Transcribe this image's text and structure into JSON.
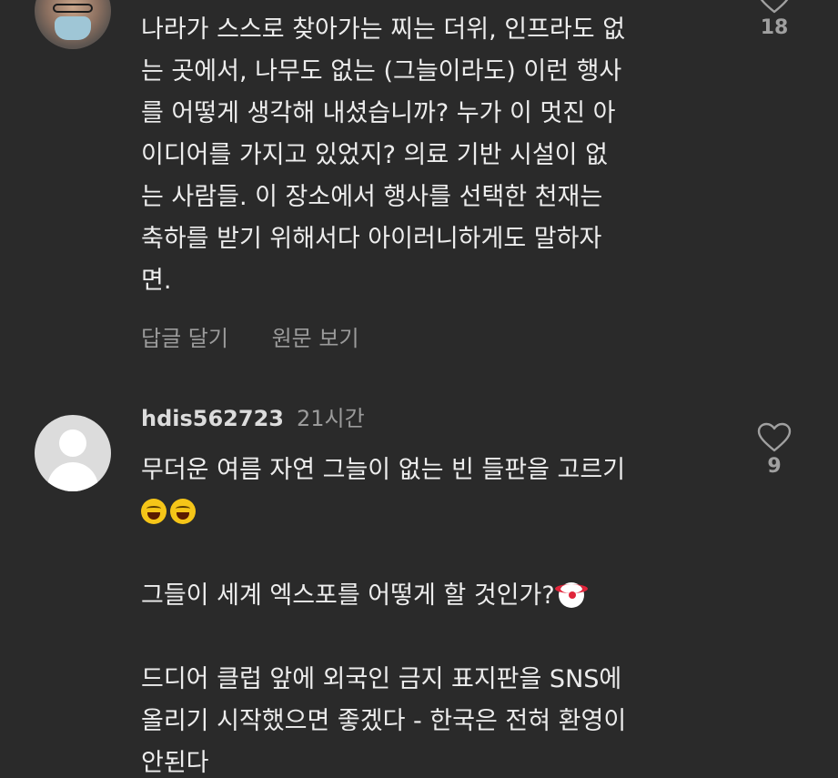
{
  "comments": [
    {
      "username": "",
      "time": "",
      "lines": [
        "나라가 스스로 찾아가는 찌는 더위, 인프라도 없",
        "는 곳에서, 나무도 없는 (그늘이라도) 이런 행사",
        "를 어떻게 생각해 내셨습니까? 누가 이 멋진 아",
        "이디어를 가지고 있었지? 의료 기반 시설이 없",
        "는 사람들. 이 장소에서 행사를 선택한 천재는",
        "축하를 받기 위해서다 아이러니하게도 말하자",
        "면."
      ],
      "likes": "18",
      "actions": {
        "reply": "답글 달기",
        "view_original": "원문 보기"
      }
    },
    {
      "username": "hdis562723",
      "time": "21시간",
      "lines": [
        "무더운 여름 자연 그늘이 없는 빈 들판을 고르기",
        "",
        "",
        "그들이 세계 엑스포를 어떻게 할 것인가?",
        "",
        "드디어 클럽 앞에 외국인 금지 표지판을 SNS에",
        "올리기 시작했으면 좋겠다 - 한국은 전혀 환영이",
        "안된다"
      ],
      "likes": "9",
      "emojis": {
        "line2": [
          "rolling-on-floor-laughing",
          "rolling-on-floor-laughing"
        ],
        "line4": [
          "clown-face"
        ]
      }
    }
  ],
  "icons": {
    "like": "heart-outline-icon"
  },
  "colors": {
    "background": "#2a2a2a",
    "text": "#ededed",
    "muted": "#9b9b9b"
  }
}
